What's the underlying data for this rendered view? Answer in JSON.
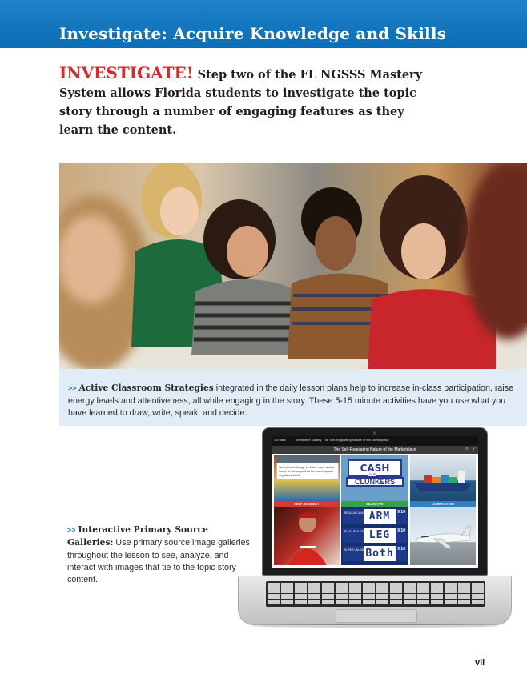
{
  "header": {
    "title": "Investigate: Acquire Knowledge and Skills"
  },
  "intro": {
    "keyword": "INVESTIGATE!",
    "text": "Step two of the FL NGSSS Mastery System allows Florida students to investigate the topic story through a number of engaging features as they learn the content."
  },
  "photo": {
    "subject": "students-in-classroom"
  },
  "features": [
    {
      "marker": ">>",
      "lead": "Active Classroom Strategies",
      "text": " integrated in the daily lesson plans help to increase in-class participation, raise energy levels and attentiveness, all while engaging in the story. These 5-15 minute activities have you use what you have learned to draw, write, speak, and decide."
    },
    {
      "marker": ">>",
      "lead": "Interactive Primary Source Galleries:",
      "text": " Use primary source image galleries throughout the lesson to see, analyze, and interact with images that tie to the topic story content."
    }
  ],
  "laptop_screen": {
    "topbar_left": "Go back",
    "topbar_title": "Interactive Gallery: The Self-Regulating Nature of the Marketplace",
    "heading": "The Self-Regulating Nature of the Marketplace",
    "note": "Select each image to learn more about some of the ways that the marketplace regulates itself.",
    "labels": [
      "SELF-INTEREST",
      "INCENTIVE",
      "COMPETITION"
    ],
    "sign_top": "CASH",
    "sign_for": "FOR",
    "sign_bottom": "CLUNKERS",
    "prices": [
      {
        "grade": "REGULAR UNLEADED",
        "word": "ARM",
        "frac": "9 10"
      },
      {
        "grade": "PLUS UNLEADED",
        "word": "LEG",
        "frac": "9 10"
      },
      {
        "grade": "SUPER UNLEADED",
        "word": "Both",
        "frac": "9 10"
      }
    ]
  },
  "colors": {
    "header": "#0b6db4",
    "keyword": "#e0262b",
    "caption_bg": "#e1ecf6",
    "arrow": "#1f82c9"
  },
  "page_number": "vii"
}
